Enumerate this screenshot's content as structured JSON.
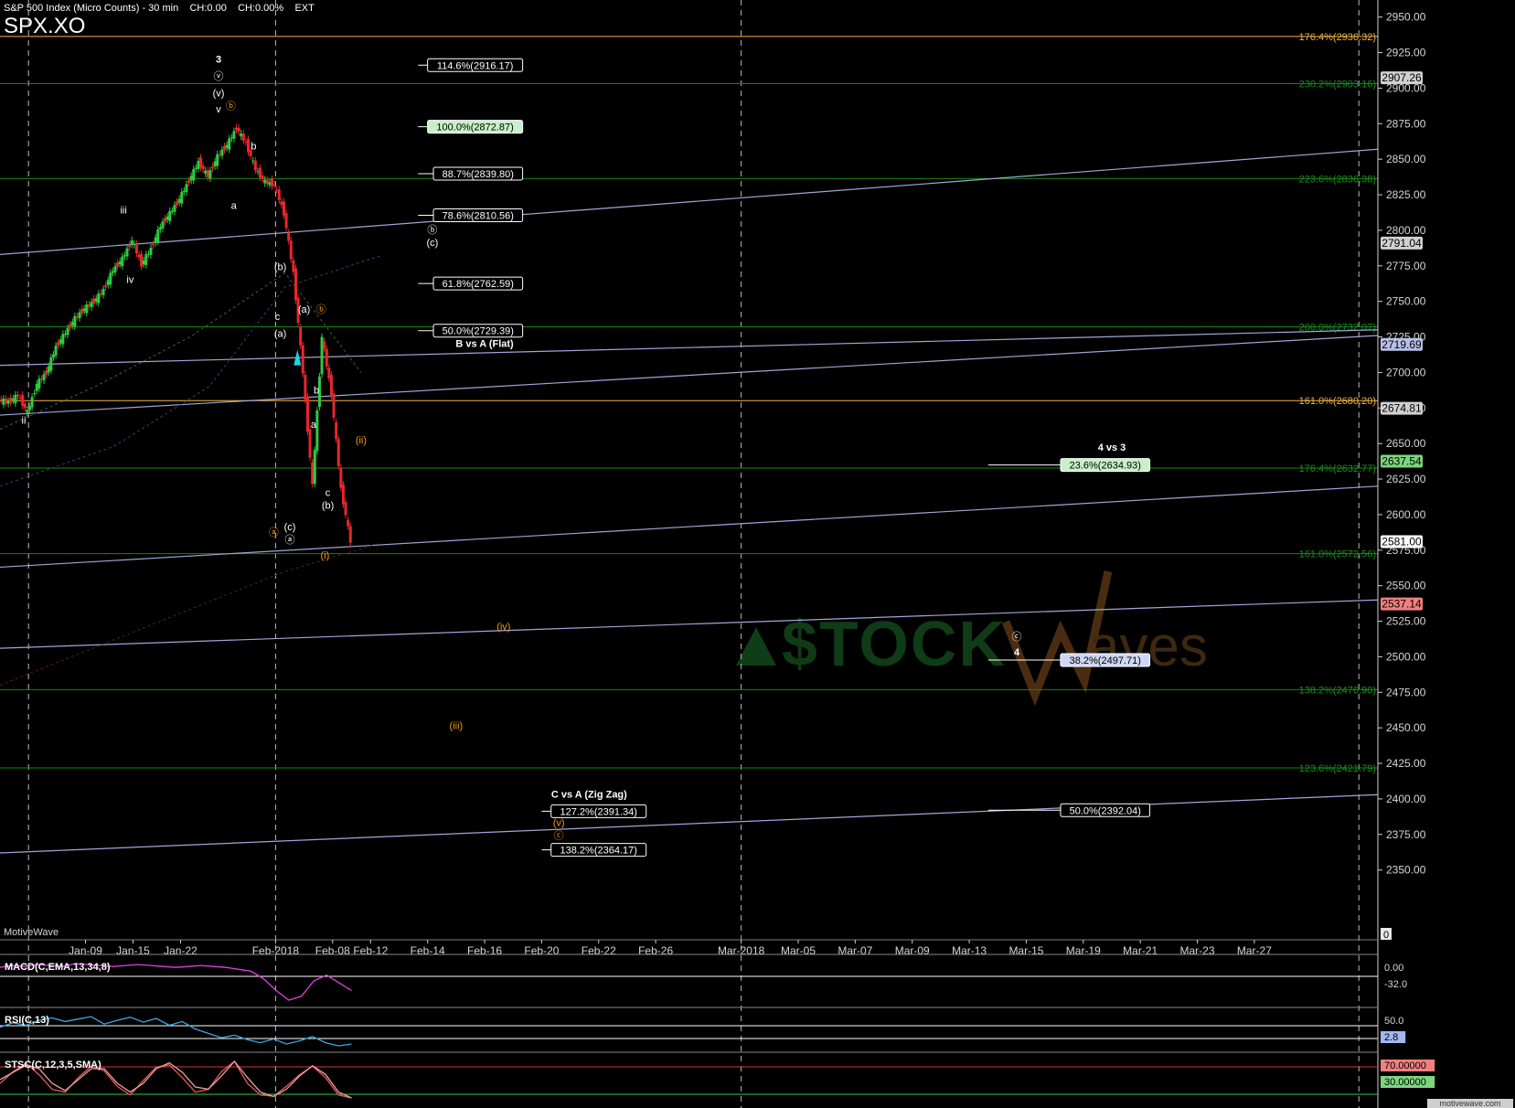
{
  "header": {
    "chart_name": "S&P 500 Index (Micro Counts)",
    "interval": "30 min",
    "change": "CH:0.00",
    "change_pct": "CH:0.00%",
    "session": "EXT",
    "symbol": "SPX.XO"
  },
  "watermark": {
    "credit": "MotiveWave",
    "brand_left": "$TOCK",
    "brand_right": "aves",
    "footer": "motivewave.com"
  },
  "colors": {
    "background": "#000000",
    "green_line": "#118a11",
    "orange_line": "#f5b642",
    "trend_line": "#9fa6d8",
    "grid": "#d0d0d0",
    "up_candle": "#2ecc40",
    "down_candle": "#e8262c",
    "wave_white": "#ffffff",
    "wave_orange": "#f39c12"
  },
  "chart_data": [
    {
      "type": "line",
      "title": "S&P 500 Index (Micro Counts) - 30 min",
      "y_axis": {
        "range": [
          2335,
          2962
        ],
        "ticks": [
          2350,
          2375,
          2400,
          2425,
          2450,
          2475,
          2500,
          2525,
          2550,
          2575,
          2600,
          2625,
          2650,
          2675,
          2700,
          2725,
          2750,
          2775,
          2800,
          2825,
          2850,
          2875,
          2900,
          2925,
          2950
        ],
        "tick_labels": [
          "2350.00",
          "2375.00",
          "2400.00",
          "2425.00",
          "2450.00",
          "2475.00",
          "2500.00",
          "2525.00",
          "2550.00",
          "2575.00",
          "2600.00",
          "2625.00",
          "2650.00",
          "2675.00",
          "2700.00",
          "2725.00",
          "2750.00",
          "2775.00",
          "2800.00",
          "2825.00",
          "2850.00",
          "2875.00",
          "2900.00",
          "2925.00",
          "2950.00"
        ],
        "price_tags": [
          {
            "label": "2907.26",
            "value": 2907.26,
            "color": "#d0d0d0"
          },
          {
            "label": "2791.04",
            "value": 2791.04,
            "color": "#d0d0d0"
          },
          {
            "label": "2719.69",
            "value": 2719.69,
            "color": "#b8bfe8"
          },
          {
            "label": "2674.81",
            "value": 2674.81,
            "color": "#d0d0d0"
          },
          {
            "label": "2637.54",
            "value": 2637.54,
            "color": "#7cd67c"
          },
          {
            "label": "2581.00",
            "value": 2581.0,
            "color": "#ffffff"
          },
          {
            "label": "2537.14",
            "value": 2537.14,
            "color": "#f08080"
          }
        ],
        "zero_tag": "0"
      },
      "x_axis": {
        "ticks": [
          {
            "label": "Jan-09",
            "i": 9
          },
          {
            "label": "Jan-15",
            "i": 14
          },
          {
            "label": "Jan-22",
            "i": 19
          },
          {
            "label": "Feb-2018",
            "i": 29
          },
          {
            "label": "Feb-08",
            "i": 35
          },
          {
            "label": "Feb-12",
            "i": 39
          },
          {
            "label": "Feb-14",
            "i": 45
          },
          {
            "label": "Feb-16",
            "i": 51
          },
          {
            "label": "Feb-20",
            "i": 57
          },
          {
            "label": "Feb-22",
            "i": 63
          },
          {
            "label": "Feb-26",
            "i": 69
          },
          {
            "label": "Mar-2018",
            "i": 78
          },
          {
            "label": "Mar-05",
            "i": 84
          },
          {
            "label": "Mar-07",
            "i": 90
          },
          {
            "label": "Mar-09",
            "i": 96
          },
          {
            "label": "Mar-13",
            "i": 102
          },
          {
            "label": "Mar-15",
            "i": 108
          },
          {
            "label": "Mar-19",
            "i": 114
          },
          {
            "label": "Mar-21",
            "i": 120
          },
          {
            "label": "Mar-23",
            "i": 126
          },
          {
            "label": "Mar-27",
            "i": 132
          }
        ],
        "dashed_at": [
          3,
          29,
          78,
          143
        ],
        "index_range": [
          0,
          145
        ]
      },
      "price_series": {
        "name": "SPX",
        "points": [
          [
            0,
            2681
          ],
          [
            1,
            2679
          ],
          [
            2,
            2684
          ],
          [
            3,
            2672
          ],
          [
            4,
            2692
          ],
          [
            5,
            2700
          ],
          [
            6,
            2718
          ],
          [
            7,
            2728
          ],
          [
            8,
            2738
          ],
          [
            9,
            2745
          ],
          [
            10,
            2750
          ],
          [
            11,
            2758
          ],
          [
            12,
            2772
          ],
          [
            13,
            2780
          ],
          [
            14,
            2793
          ],
          [
            15,
            2776
          ],
          [
            16,
            2787
          ],
          [
            17,
            2803
          ],
          [
            18,
            2812
          ],
          [
            19,
            2822
          ],
          [
            20,
            2835
          ],
          [
            21,
            2848
          ],
          [
            22,
            2838
          ],
          [
            23,
            2852
          ],
          [
            24,
            2860
          ],
          [
            25,
            2872
          ],
          [
            26,
            2861
          ],
          [
            27,
            2843
          ],
          [
            28,
            2834
          ],
          [
            29,
            2832
          ],
          [
            30,
            2812
          ],
          [
            31,
            2770
          ],
          [
            32,
            2700
          ],
          [
            33,
            2620
          ],
          [
            34,
            2725
          ],
          [
            35,
            2685
          ],
          [
            36,
            2618
          ],
          [
            37,
            2581
          ]
        ]
      },
      "fib_lines_green": [
        {
          "label": "230.2%(2903.16)",
          "value": 2903.16
        },
        {
          "label": "223.6%(2836.38)",
          "value": 2836.38
        },
        {
          "label": "200.0%(2732.07)",
          "value": 2732.07
        },
        {
          "label": "176.4%(2632.77)",
          "value": 2632.77
        },
        {
          "label": "161.0%(2572.56)",
          "value": 2572.56
        },
        {
          "label": "138.2%(2476.90)",
          "value": 2476.9
        },
        {
          "label": "123.6%(2421.79)",
          "value": 2421.79
        }
      ],
      "fib_lines_orange": [
        {
          "label": "176.4%(2936.32)",
          "value": 2936.32
        },
        {
          "label": "161.0%(2680.20)",
          "value": 2680.2
        }
      ],
      "fib_boxes": [
        {
          "label": "114.6%(2916.17)",
          "value": 2916.17,
          "i0": 44,
          "i1": 55,
          "style": "plain"
        },
        {
          "label": "100.0%(2872.87)",
          "value": 2872.87,
          "i0": 44,
          "i1": 55,
          "style": "green"
        },
        {
          "label": "88.7%(2839.80)",
          "value": 2839.8,
          "i0": 44,
          "i1": 55,
          "style": "plain"
        },
        {
          "label": "78.6%(2810.56)",
          "value": 2810.56,
          "i0": 44,
          "i1": 55,
          "style": "plain"
        },
        {
          "label": "61.8%(2762.59)",
          "value": 2762.59,
          "i0": 44,
          "i1": 55,
          "style": "plain"
        },
        {
          "label": "50.0%(2729.39)",
          "value": 2729.39,
          "i0": 44,
          "i1": 55,
          "style": "plain"
        },
        {
          "label": "23.6%(2634.93)",
          "value": 2634.93,
          "i0": 104,
          "i1": 121,
          "style": "green"
        },
        {
          "label": "38.2%(2497.71)",
          "value": 2497.71,
          "i0": 104,
          "i1": 121,
          "style": "blue"
        },
        {
          "label": "50.0%(2392.04)",
          "value": 2392.04,
          "i0": 104,
          "i1": 121,
          "style": "plain"
        },
        {
          "label": "127.2%(2391.34)",
          "value": 2391.34,
          "i0": 57,
          "i1": 68,
          "style": "plain"
        },
        {
          "label": "138.2%(2364.17)",
          "value": 2364.17,
          "i0": 57,
          "i1": 68,
          "style": "plain"
        }
      ],
      "trend_lines": [
        {
          "from": [
            0,
            2783
          ],
          "to": [
            145,
            2857
          ]
        },
        {
          "from": [
            0,
            2705
          ],
          "to": [
            145,
            2730
          ]
        },
        {
          "from": [
            0,
            2670
          ],
          "to": [
            145,
            2726
          ]
        },
        {
          "from": [
            0,
            2563
          ],
          "to": [
            145,
            2620
          ]
        },
        {
          "from": [
            0,
            2506
          ],
          "to": [
            145,
            2540
          ]
        },
        {
          "from": [
            0,
            2362
          ],
          "to": [
            145,
            2403
          ]
        }
      ],
      "captions": [
        {
          "text": "B vs A (Flat)",
          "i": 51,
          "value": 2718
        },
        {
          "text": "4 vs 3",
          "i": 117,
          "value": 2645
        },
        {
          "text": "C vs A (Zig Zag)",
          "i": 62,
          "value": 2401
        }
      ],
      "wave_labels": [
        {
          "text": "3",
          "i": 23,
          "value": 2918,
          "color": "white",
          "bold": true
        },
        {
          "text": "ⓥ",
          "i": 23,
          "value": 2906,
          "color": "white"
        },
        {
          "text": "(v)",
          "i": 23,
          "value": 2894,
          "color": "white"
        },
        {
          "text": "v",
          "i": 23,
          "value": 2883,
          "color": "white"
        },
        {
          "text": "ⓑ",
          "i": 24.3,
          "value": 2885,
          "color": "orange"
        },
        {
          "text": "iii",
          "i": 13,
          "value": 2812,
          "color": "white"
        },
        {
          "text": "iv",
          "i": 13.7,
          "value": 2763,
          "color": "white"
        },
        {
          "text": "ii",
          "i": 2.5,
          "value": 2664,
          "color": "white"
        },
        {
          "text": "b",
          "i": 26.7,
          "value": 2857,
          "color": "white"
        },
        {
          "text": "a",
          "i": 24.6,
          "value": 2815,
          "color": "white"
        },
        {
          "text": "(b)",
          "i": 29.5,
          "value": 2772,
          "color": "white"
        },
        {
          "text": "c",
          "i": 29.2,
          "value": 2737,
          "color": "white"
        },
        {
          "text": "(a)",
          "i": 29.5,
          "value": 2725,
          "color": "white"
        },
        {
          "text": "(a)",
          "i": 32,
          "value": 2742,
          "color": "white"
        },
        {
          "text": "ⓑ",
          "i": 33.8,
          "value": 2742,
          "color": "orange"
        },
        {
          "text": "b",
          "i": 33.3,
          "value": 2685,
          "color": "white"
        },
        {
          "text": "a",
          "i": 33,
          "value": 2661,
          "color": "white"
        },
        {
          "text": "(ii)",
          "i": 38,
          "value": 2650,
          "color": "orange"
        },
        {
          "text": "c",
          "i": 34.5,
          "value": 2613,
          "color": "white"
        },
        {
          "text": "(b)",
          "i": 34.5,
          "value": 2604,
          "color": "white"
        },
        {
          "text": "(c)",
          "i": 30.5,
          "value": 2589,
          "color": "white"
        },
        {
          "text": "ⓐ",
          "i": 28.8,
          "value": 2585,
          "color": "orange"
        },
        {
          "text": "ⓐ",
          "i": 30.5,
          "value": 2580,
          "color": "white"
        },
        {
          "text": "(i)",
          "i": 34.2,
          "value": 2569,
          "color": "orange"
        },
        {
          "text": "ⓑ",
          "i": 45.5,
          "value": 2798,
          "color": "white"
        },
        {
          "text": "(c)",
          "i": 45.5,
          "value": 2789,
          "color": "white"
        },
        {
          "text": "(iv)",
          "i": 53,
          "value": 2519,
          "color": "orange"
        },
        {
          "text": "(iii)",
          "i": 48,
          "value": 2449,
          "color": "orange"
        },
        {
          "text": "(v)",
          "i": 58.8,
          "value": 2381,
          "color": "orange"
        },
        {
          "text": "ⓒ",
          "i": 58.8,
          "value": 2372,
          "color": "orange"
        },
        {
          "text": "ⓒ",
          "i": 107,
          "value": 2512,
          "color": "white"
        },
        {
          "text": "4",
          "i": 107,
          "value": 2501,
          "color": "white",
          "bold": true
        }
      ],
      "grid": false,
      "legend": "none"
    },
    {
      "type": "line",
      "title": "MACD(C,EMA,13,34,8)",
      "tick_labels": [
        "0.00",
        "-32.0"
      ],
      "series": [
        {
          "name": "MACD",
          "values": [
            4,
            6,
            5,
            7,
            6,
            5,
            8,
            7,
            6,
            5,
            6,
            7,
            6,
            5,
            4,
            5,
            6,
            5,
            4,
            2,
            0,
            -8,
            -20,
            -30,
            -26,
            -10,
            -4,
            -12,
            -20
          ]
        }
      ]
    },
    {
      "type": "line",
      "title": "RSI(C,13)",
      "tick_labels": [
        "50.0",
        "2.8"
      ],
      "series": [
        {
          "name": "RSI",
          "values": [
            55,
            62,
            58,
            66,
            70,
            64,
            68,
            72,
            60,
            66,
            71,
            63,
            69,
            58,
            64,
            52,
            45,
            38,
            42,
            35,
            30,
            36,
            28,
            33,
            40,
            30,
            25,
            28
          ]
        }
      ]
    },
    {
      "type": "line",
      "title": "STSC(C,12,3,5,SMA)",
      "tick_labels": [
        "70.00000",
        "30.00000"
      ],
      "series": [
        {
          "name": "K",
          "values": [
            40,
            60,
            75,
            55,
            30,
            25,
            50,
            70,
            62,
            35,
            20,
            45,
            68,
            72,
            50,
            25,
            30,
            60,
            78,
            40,
            20,
            18,
            35,
            55,
            70,
            50,
            20,
            15
          ]
        },
        {
          "name": "D",
          "values": [
            45,
            55,
            65,
            60,
            40,
            30,
            45,
            60,
            60,
            40,
            28,
            40,
            60,
            68,
            55,
            35,
            32,
            50,
            70,
            48,
            28,
            22,
            32,
            50,
            64,
            52,
            28,
            20
          ]
        }
      ]
    }
  ]
}
